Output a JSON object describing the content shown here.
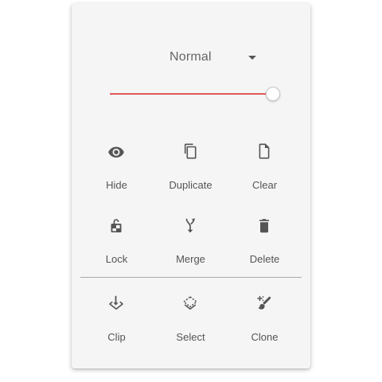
{
  "blend_mode": {
    "selected": "Normal",
    "icon": "caret-down-icon"
  },
  "opacity_slider": {
    "value_fraction": 1.0,
    "accent_color": "#e05a5a"
  },
  "tools": [
    {
      "label": "Hide",
      "icon": "eye-icon"
    },
    {
      "label": "Duplicate",
      "icon": "copy-icon"
    },
    {
      "label": "Clear",
      "icon": "blank-page-icon"
    },
    {
      "label": "Lock",
      "icon": "padlock-icon"
    },
    {
      "label": "Merge",
      "icon": "merge-arrows-icon"
    },
    {
      "label": "Delete",
      "icon": "trash-icon"
    },
    {
      "label": "Clip",
      "icon": "clip-layer-icon"
    },
    {
      "label": "Select",
      "icon": "select-layer-icon"
    },
    {
      "label": "Clone",
      "icon": "clone-stamp-icon"
    }
  ],
  "colors": {
    "panel_background": "#f5f5f5",
    "icon_color": "#555555",
    "text_color": "#555555"
  }
}
